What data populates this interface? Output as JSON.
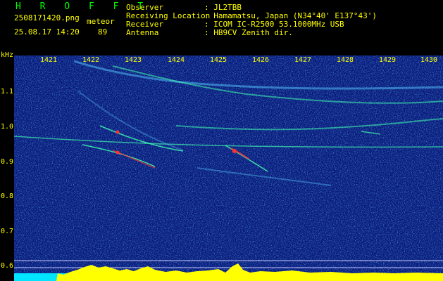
{
  "header": {
    "logo": "H R O F F T",
    "filename": "2508171420.png",
    "datetime": "25.08.17 14:20",
    "mode_label": "meteor",
    "count": "89"
  },
  "info": {
    "observer_label": "Observer",
    "observer_value": ": JL2TBB",
    "location_label": "Receiving Location",
    "location_value": ": Hamamatsu, Japan (N34°40' E137°43')",
    "receiver_label": "Receiver",
    "receiver_value": ": ICOM IC-R2500 53.1000MHz USB",
    "antenna_label": "Antenna",
    "antenna_value": ": HB9CV Zenith dir."
  },
  "axis": {
    "y_unit": "kHz",
    "y_ticks": [
      "1.1",
      "1.0",
      "0.9",
      "0.8",
      "0.7",
      "0.6"
    ],
    "x_ticks": [
      "1421",
      "1422",
      "1423",
      "1424",
      "1425",
      "1426",
      "1427",
      "1428",
      "1429",
      "1430"
    ]
  },
  "colors": {
    "background": "#0a1a7a",
    "label": "#ffff00",
    "accent": "#00ff00",
    "signal_hot": "#ff3030",
    "signal_mid": "#40ffb0"
  }
}
